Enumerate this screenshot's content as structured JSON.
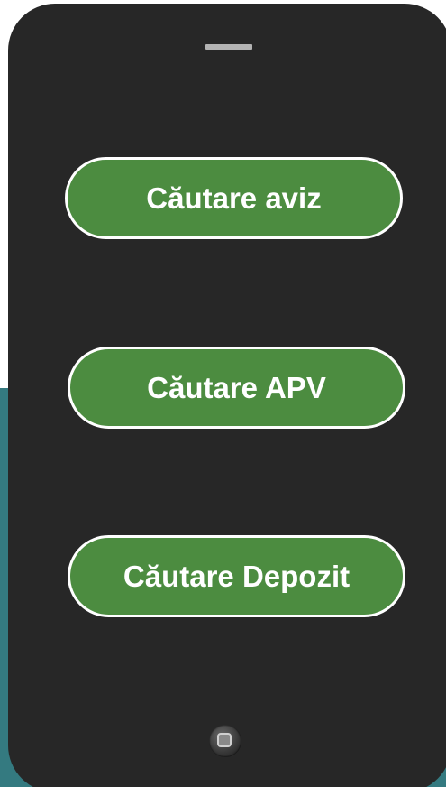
{
  "colors": {
    "background_band": "#347a80",
    "phone_body": "#272727",
    "button_fill": "#4c8c40",
    "button_border": "#ffffff",
    "button_text": "#ffffff"
  },
  "menu": {
    "buttons": [
      {
        "label": "Căutare aviz"
      },
      {
        "label": "Căutare APV"
      },
      {
        "label": "Căutare Depozit"
      }
    ]
  },
  "device": {
    "speaker_icon": "speaker-grille-icon",
    "home_icon": "home-button-icon"
  }
}
